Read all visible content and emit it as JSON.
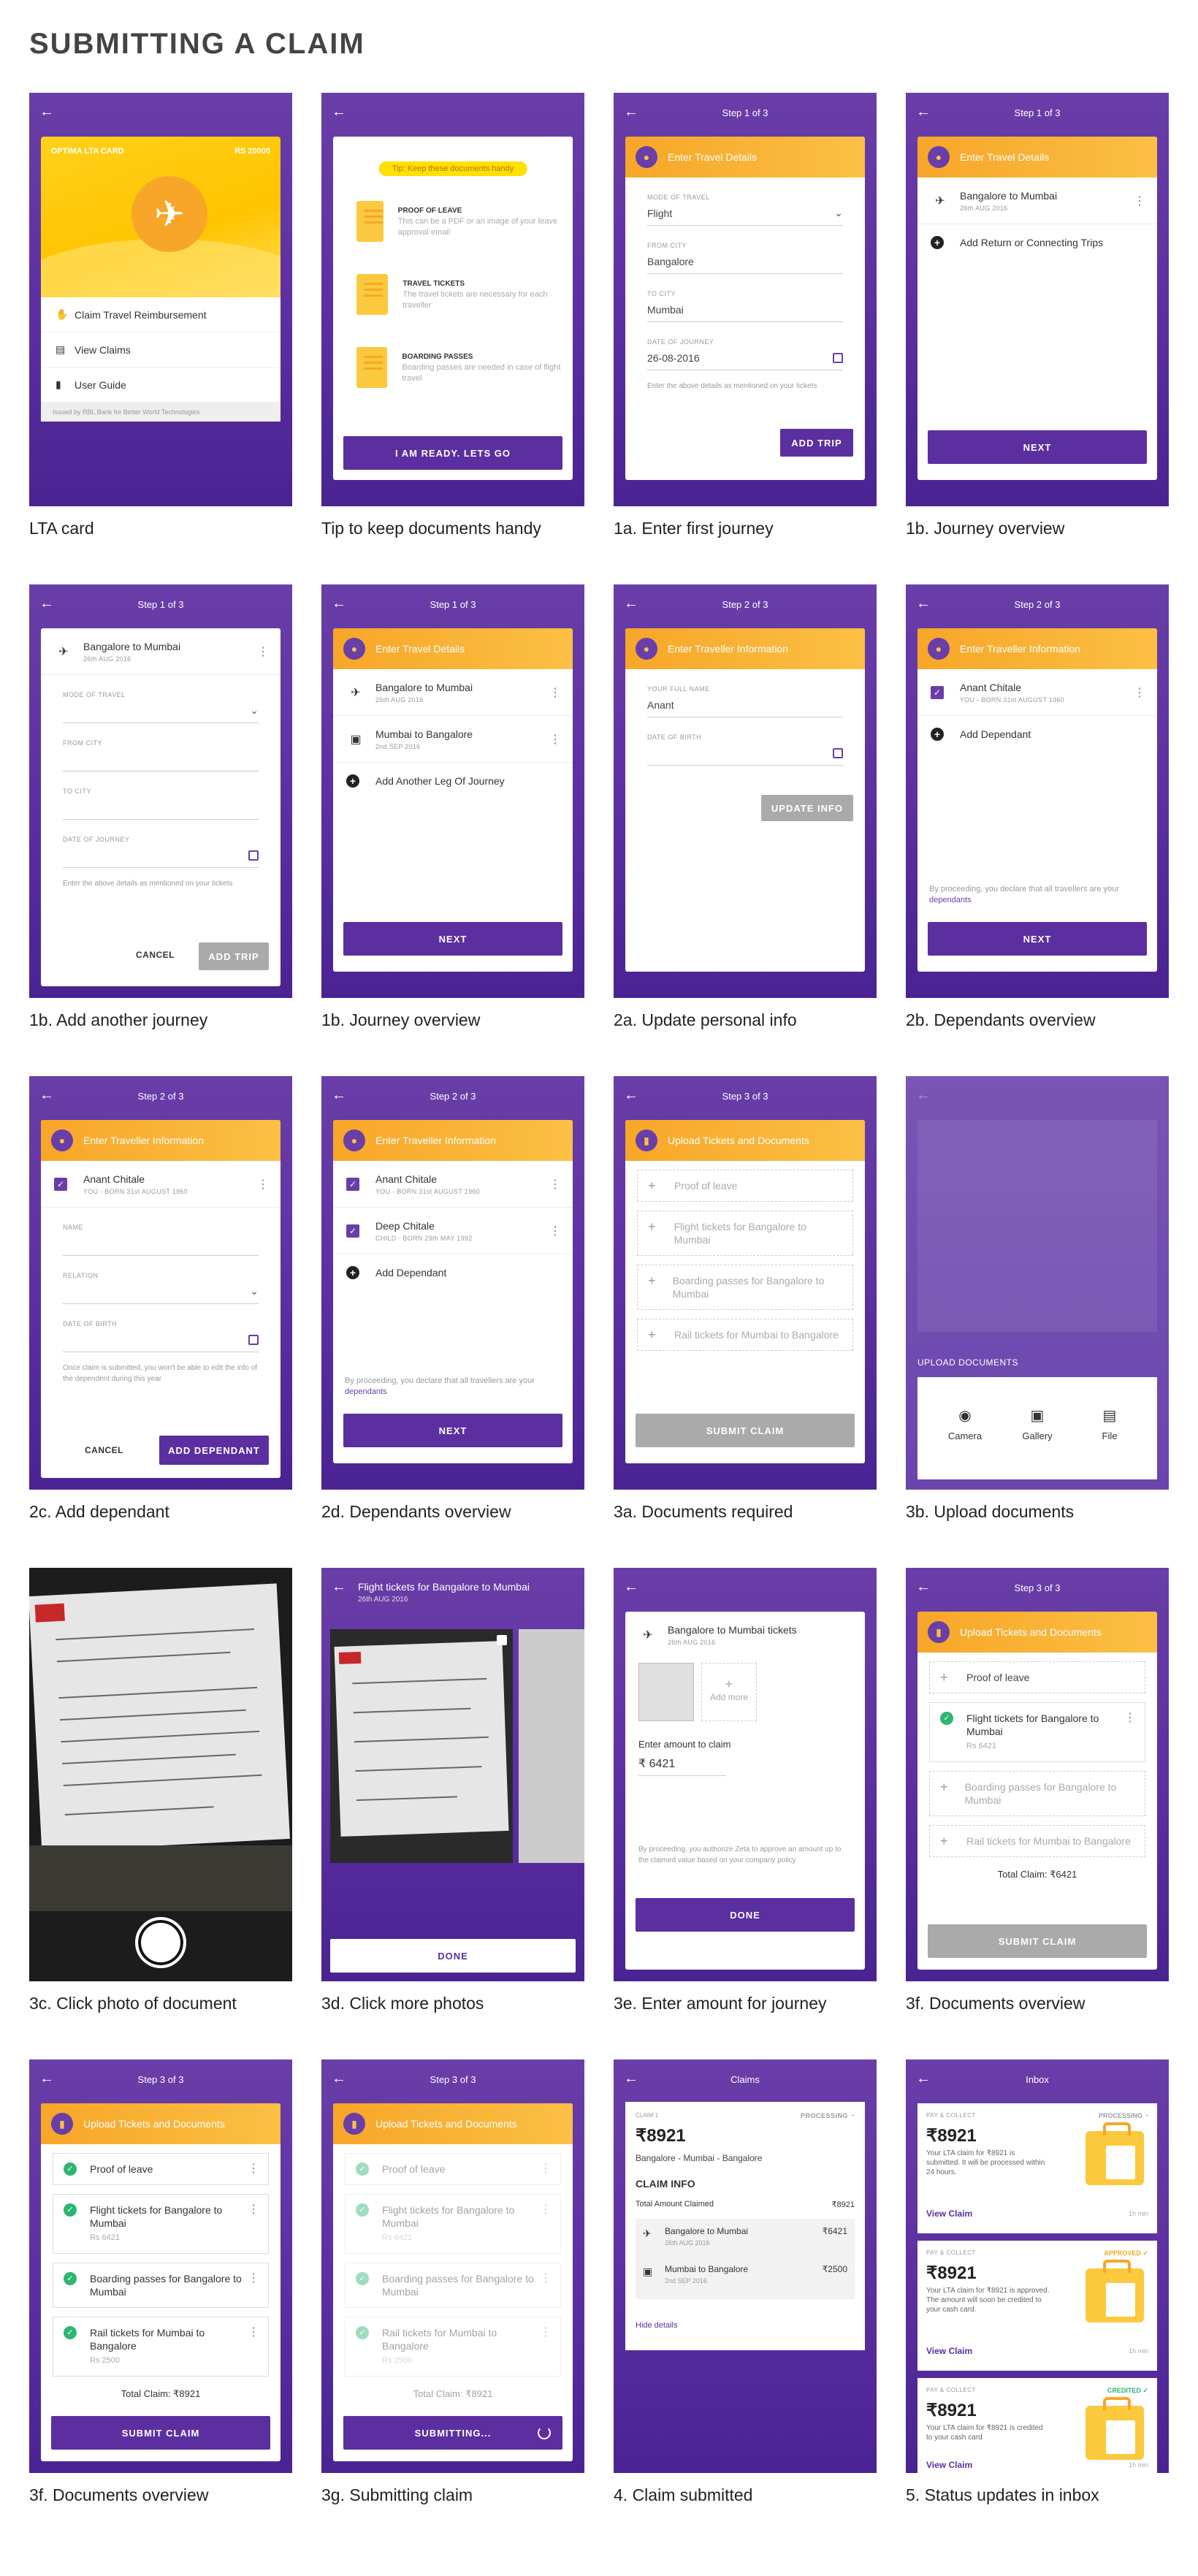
{
  "page_title": "SUBMITTING A CLAIM",
  "colors": {
    "primary": "#5b2fa0",
    "accent": "#f7a628",
    "success": "#2bb673"
  },
  "captions": [
    "LTA card",
    "Tip to keep documents handy",
    "1a. Enter first journey",
    "1b. Journey overview",
    "1b. Add another journey",
    "1b. Journey overview",
    "2a. Update personal info",
    "2b. Dependants overview",
    "2c. Add dependant",
    "2d. Dependants overview",
    "3a. Documents required",
    "3b. Upload documents",
    "3c. Click photo of document",
    "3d. Click more photos",
    "3e. Enter amount for journey",
    "3f. Documents overview",
    "3f. Documents overview",
    "3g. Submitting claim",
    "4. Claim submitted",
    "5. Status updates in inbox"
  ],
  "steps": {
    "s1": "Step 1 of 3",
    "s2": "Step 2 of 3",
    "s3": "Step 3 of 3"
  },
  "lta": {
    "card_name": "OPTIMA LTA CARD",
    "amount": "RS 20000",
    "menu": [
      "Claim Travel Reimbursement",
      "View Claims",
      "User Guide"
    ],
    "footer": "Issued by RBL Bank for Better World Technologies"
  },
  "tip": {
    "banner": "Tip: Keep these documents handy",
    "items": [
      {
        "title": "PROOF OF LEAVE",
        "desc": "This can be a PDF or an image of your leave approval email"
      },
      {
        "title": "TRAVEL TICKETS",
        "desc": "The travel tickets are necessary for each traveller"
      },
      {
        "title": "BOARDING PASSES",
        "desc": "Boarding passes are needed in case of flight travel"
      }
    ],
    "button": "I AM READY. LETS GO"
  },
  "travel": {
    "header": "Enter Travel Details",
    "mode_label": "MODE OF TRAVEL",
    "mode_value": "Flight",
    "from_label": "FROM CITY",
    "from_value": "Bangalore",
    "to_label": "TO CITY",
    "to_value": "Mumbai",
    "date_label": "DATE OF JOURNEY",
    "date_value": "26-08-2016",
    "note": "Enter the above details as mentioned on your tickets",
    "add_trip": "ADD TRIP",
    "cancel": "CANCEL",
    "add_return": "Add Return or Connecting Trips",
    "add_leg": "Add Another Leg Of Journey",
    "next": "NEXT"
  },
  "journeys": [
    {
      "title": "Bangalore to Mumbai",
      "date": "26th AUG 2016"
    },
    {
      "title": "Mumbai to Bangalore",
      "date": "2nd SEP 2016"
    }
  ],
  "traveller": {
    "header": "Enter Traveller Information",
    "fullname_label": "YOUR FULL NAME",
    "fullname_value": "Anant",
    "dob_label": "DATE OF BIRTH",
    "update_btn": "UPDATE INFO",
    "self_name": "Anant Chitale",
    "self_sub": "YOU - BORN 31st AUGUST 1960",
    "dep_name": "Deep Chitale",
    "dep_sub": "CHILD - BORN 29th MAY 1992",
    "add_dependant": "Add Dependant",
    "declare": "By proceeding, you declare that all travellers are your",
    "declare_link": "dependants",
    "name_label": "NAME",
    "relation_label": "RELATION",
    "dep_note": "Once claim is submitted, you won't be able to edit the info of the dependent during this year",
    "add_dep_btn": "ADD DEPENDANT"
  },
  "docs": {
    "header": "Upload Tickets and Documents",
    "items": [
      "Proof of leave",
      "Flight tickets for Bangalore to Mumbai",
      "Boarding passes for Bangalore to Mumbai",
      "Rail tickets for Mumbai to Bangalore"
    ],
    "amounts": [
      "Rs 6421",
      "Rs 2500"
    ],
    "submit": "SUBMIT CLAIM",
    "submitting": "SUBMITTING...",
    "total": "Total Claim: ₹6421",
    "total_full": "Total Claim: ₹8921",
    "upload_label": "UPLOAD DOCUMENTS",
    "upload_opts": [
      "Camera",
      "Gallery",
      "File"
    ]
  },
  "photos": {
    "title": "Flight tickets for Bangalore to Mumbai",
    "date": "26th AUG 2016",
    "done": "DONE"
  },
  "amount": {
    "ticket_title": "Bangalore to Mumbai tickets",
    "ticket_date": "26th AUG 2016",
    "add_more": "Add more",
    "enter_label": "Enter amount to claim",
    "currency": "₹",
    "value": "6421",
    "note": "By proceeding, you authorize Zeta to approve an amount up to the claimed value based on your company policy",
    "done": "DONE"
  },
  "claim": {
    "screen_title": "Claims",
    "claim_no": "CLAIM 1",
    "status": "PROCESSING",
    "amount": "₹8921",
    "route": "Bangalore - Mumbai - Bangalore",
    "info_title": "CLAIM INFO",
    "total_label": "Total Amount Claimed",
    "total_value": "₹8921",
    "legs": [
      {
        "title": "Bangalore to Mumbai",
        "date": "26th AUG 2016",
        "amount": "₹6421"
      },
      {
        "title": "Mumbai to Bangalore",
        "date": "2nd SEP 2016",
        "amount": "₹2500"
      }
    ],
    "hide": "Hide details"
  },
  "inbox": {
    "screen_title": "Inbox",
    "cards": [
      {
        "cat": "PAY & COLLECT",
        "status": "PROCESSING",
        "status_color": "#9e9e9e",
        "amount": "₹8921",
        "desc": "Your LTA claim for ₹8921 is submitted. It will be processed within 24 hours.",
        "link": "View Claim",
        "time": "1h min"
      },
      {
        "cat": "PAY & COLLECT",
        "status": "APPROVED",
        "status_color": "#f7a628",
        "amount": "₹8921",
        "desc": "Your LTA claim for ₹8921 is approved. The amount will soon be credited to your cash card.",
        "link": "View Claim",
        "time": "1h min"
      },
      {
        "cat": "PAY & COLLECT",
        "status": "CREDITED",
        "status_color": "#2bb673",
        "amount": "₹8921",
        "desc": "Your LTA claim for ₹8921 is credited to your cash card",
        "link": "View Claim",
        "time": "1h min"
      }
    ]
  }
}
